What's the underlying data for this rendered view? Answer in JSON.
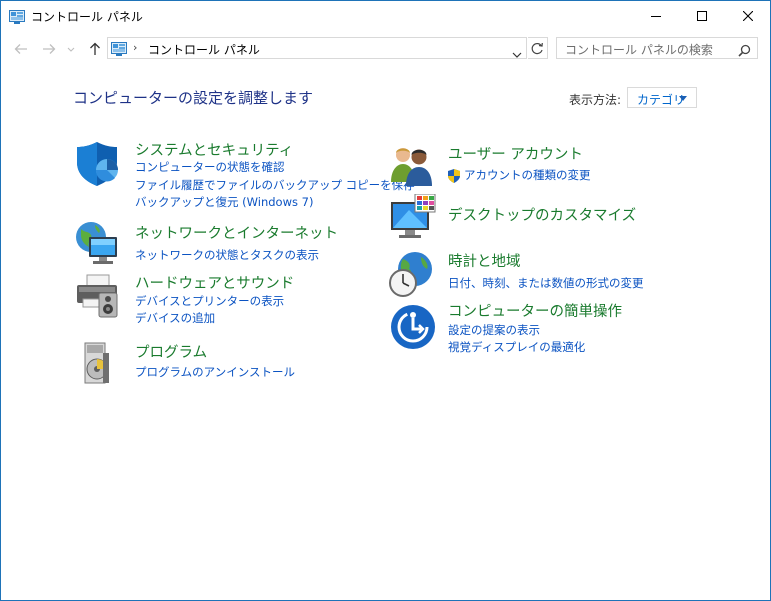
{
  "window": {
    "title": "コントロール パネル"
  },
  "nav": {
    "breadcrumb": [
      "コントロール パネル"
    ],
    "search_placeholder": "コントロール パネルの検索"
  },
  "main": {
    "title": "コンピューターの設定を調整します",
    "view_by_label": "表示方法:",
    "view_by_value": "カテゴリ"
  },
  "categories": {
    "system": {
      "title": "システムとセキュリティ",
      "links": [
        "コンピューターの状態を確認",
        "ファイル履歴でファイルのバックアップ コピーを保存",
        "バックアップと復元 (Windows 7)"
      ]
    },
    "network": {
      "title": "ネットワークとインターネット",
      "links": [
        "ネットワークの状態とタスクの表示"
      ]
    },
    "hardware": {
      "title": "ハードウェアとサウンド",
      "links": [
        "デバイスとプリンターの表示",
        "デバイスの追加"
      ]
    },
    "programs": {
      "title": "プログラム",
      "links": [
        "プログラムのアンインストール"
      ]
    },
    "users": {
      "title": "ユーザー アカウント",
      "links": [
        "アカウントの種類の変更"
      ]
    },
    "desktop": {
      "title": "デスクトップのカスタマイズ",
      "links": []
    },
    "clock": {
      "title": "時計と地域",
      "links": [
        "日付、時刻、または数値の形式の変更"
      ]
    },
    "ease": {
      "title": "コンピューターの簡単操作",
      "links": [
        "設定の提案の表示",
        "視覚ディスプレイの最適化"
      ]
    }
  },
  "colors": {
    "accent": "#1e73b8",
    "category_title": "#1a7b2e",
    "link": "#0b53c2",
    "page_title": "#1e3287"
  }
}
